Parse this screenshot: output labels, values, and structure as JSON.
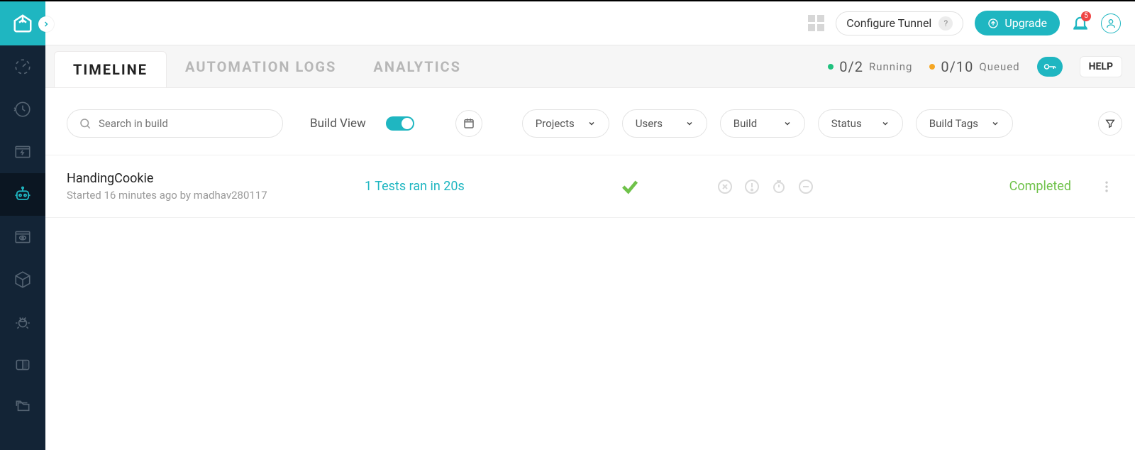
{
  "topbar": {
    "configure_tunnel": "Configure Tunnel",
    "upgrade": "Upgrade",
    "notif_badge": "5"
  },
  "tabs": {
    "timeline": "TIMELINE",
    "automation_logs": "AUTOMATION LOGS",
    "analytics": "ANALYTICS"
  },
  "counters": {
    "running_val": "0/2",
    "running_label": "Running",
    "queued_val": "0/10",
    "queued_label": "Queued"
  },
  "help": "HELP",
  "filters": {
    "search_placeholder": "Search in build",
    "build_view": "Build View",
    "projects": "Projects",
    "users": "Users",
    "build": "Build",
    "status": "Status",
    "build_tags": "Build Tags"
  },
  "row": {
    "title": "HandingCookie",
    "meta": "Started 16 minutes ago by madhav280117",
    "summary": "1 Tests ran in 20s",
    "status": "Completed"
  },
  "colors": {
    "accent": "#1fb6c1",
    "running_dot": "#1fc17e",
    "queued_dot": "#f5a623",
    "success": "#6fc24a"
  }
}
